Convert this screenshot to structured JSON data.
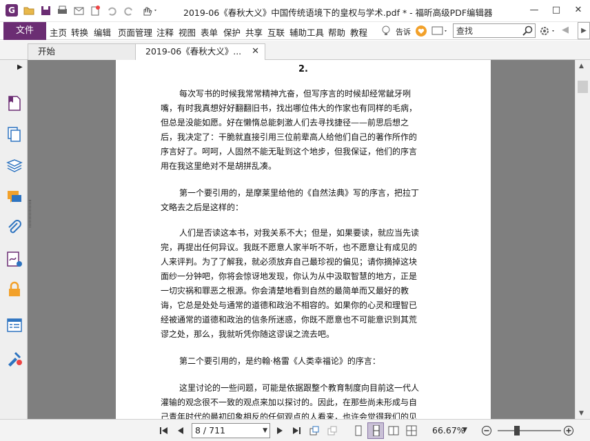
{
  "window": {
    "title": "2019-06《春秋大义》中国传统语境下的皇权与学术.pdf * - 福昕高级PDF编辑器",
    "logo": "G"
  },
  "menu": {
    "file": "文件",
    "items": [
      "主页",
      "转换",
      "编辑",
      "页面管理",
      "注释",
      "视图",
      "表单",
      "保护",
      "共享",
      "互联",
      "辅助工具",
      "帮助",
      "教程"
    ],
    "tell_me": "告诉",
    "search_placeholder": "查找"
  },
  "tabs": [
    {
      "label": "开始"
    },
    {
      "label": "2019-06《春秋大义》..."
    }
  ],
  "document": {
    "page_number": "2.",
    "paragraphs": [
      [
        "每次写书的时候我常常精神亢奋，但写序言的时候却经常龇牙咧",
        "嘴，有时我真想好好翻翻旧书，找出哪位伟大的作家也有同样的毛病，",
        "但总是没能如愿。好在懒惰总能刺激人们去寻找捷径——前思后想之",
        "后，我决定了：干脆就直接引用三位前辈高人给他们自己的著作所作的",
        "序言好了。呵呵，人固然不能无耻到这个地步，但我保证，他们的序言",
        "用在我这里绝对不是胡拼乱凑。"
      ],
      [
        "第一个要引用的，是摩莱里给他的《自然法典》写的序言，把拉丁",
        "文略去之后是这样的："
      ],
      [
        "人们是否读这本书，对我关系不大；但是，如果要读，就应当先读",
        "完，再提出任何异议。我既不愿意人家半听不听，也不愿意让有成见的",
        "人来评判。为了了解我，就必须放弃自己最珍视的偏见；请你摘掉这块",
        "面纱一分钟吧，你将会惊讶地发现，你认为从中汲取智慧的地方，正是",
        "一切灾祸和罪恶之根源。你会清楚地看到自然的最简单而又最好的教",
        "诲，它总是处处与通常的道德和政治不相容的。如果你的心灵和理智已",
        "经被通常的道德和政治的信条所迷惑，你既不愿意也不可能意识到其荒",
        "谬之处，那么，我就听凭你随这谬误之流去吧。"
      ],
      [
        "第二个要引用的，是约翰·格雷《人类幸福论》的序言："
      ],
      [
        "这里讨论的一些问题，可能是依据跟整个教育制度向目前这一代人",
        "灌输的观念很不一致的观点来加以探讨的。因此，在那些尚未形成与自",
        "己青年时代的最初印象相反的任何观点的人看来，也许会觉得我们的见"
      ]
    ]
  },
  "status": {
    "page_display": "8 / 711",
    "zoom": "66.67%",
    "zoom_fraction": 0.3
  },
  "colors": {
    "brand": "#6b2d73",
    "canvas_gray": "#7f7f7f"
  }
}
